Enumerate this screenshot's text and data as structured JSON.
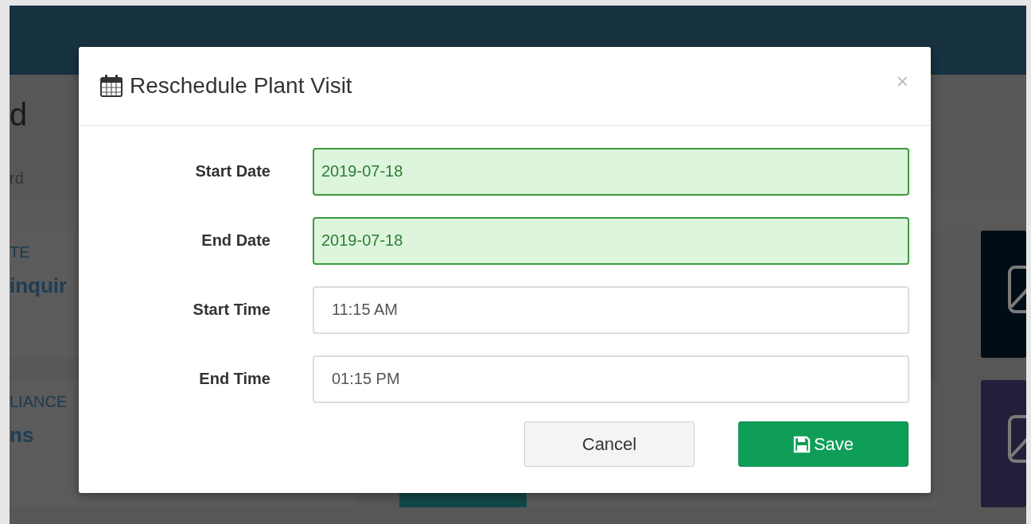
{
  "backdrop": {
    "heading": "d",
    "breadcrumb": "rd",
    "cards": [
      {
        "label": "TE",
        "value": "inquir"
      },
      {
        "label": "LIANCE",
        "value": "ns"
      }
    ],
    "tiles": [
      {
        "color": "#010d16"
      },
      {
        "color": "#221f3b"
      }
    ]
  },
  "dialog": {
    "title": "Reschedule Plant Visit",
    "close": "×",
    "fields": [
      {
        "label": "Start Date",
        "value": "2019-07-18",
        "valid": true
      },
      {
        "label": "End Date",
        "value": "2019-07-18",
        "valid": true
      },
      {
        "label": "Start Time",
        "value": "11:15 AM",
        "valid": false
      },
      {
        "label": "End Time",
        "value": "01:15 PM",
        "valid": false
      }
    ],
    "buttons": [
      {
        "label": "Cancel",
        "kind": "secondary"
      },
      {
        "label": "Save",
        "kind": "primary"
      }
    ]
  }
}
